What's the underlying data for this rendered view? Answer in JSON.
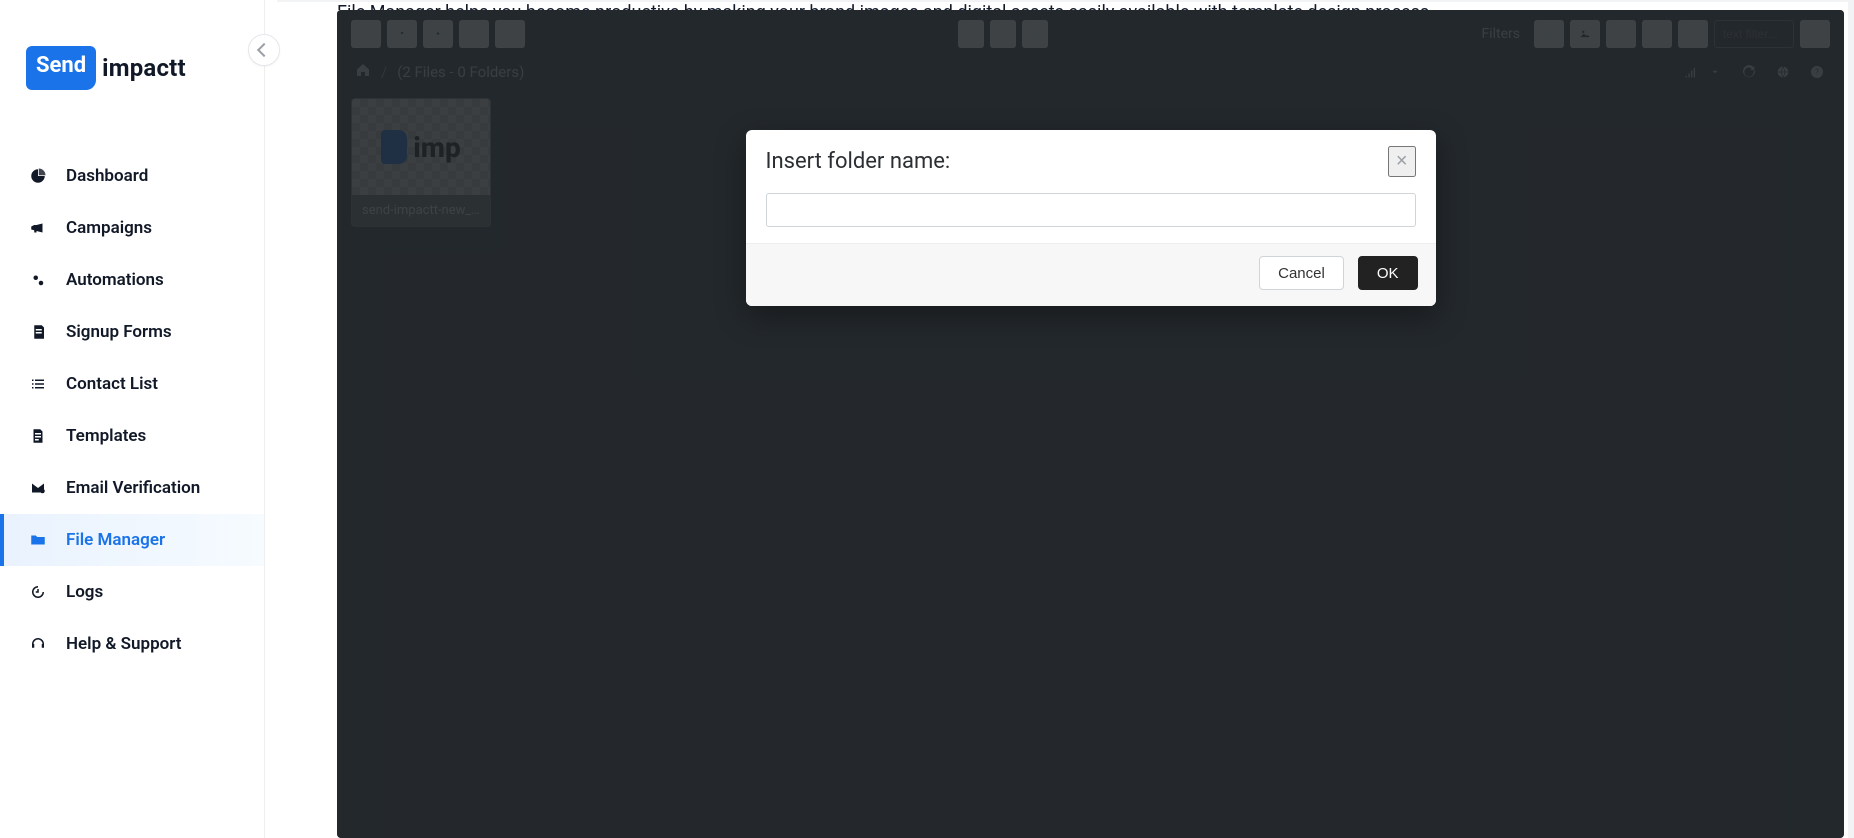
{
  "brand": {
    "badge_text": "Send",
    "word": "impactt"
  },
  "sidebar": {
    "items": [
      {
        "label": "Dashboard",
        "icon": "pie-icon"
      },
      {
        "label": "Campaigns",
        "icon": "megaphone-icon"
      },
      {
        "label": "Automations",
        "icon": "gears-icon"
      },
      {
        "label": "Signup Forms",
        "icon": "form-icon"
      },
      {
        "label": "Contact List",
        "icon": "list-icon"
      },
      {
        "label": "Templates",
        "icon": "template-icon"
      },
      {
        "label": "Email Verification",
        "icon": "shield-check-icon"
      },
      {
        "label": "File Manager",
        "icon": "folder-icon"
      },
      {
        "label": "Logs",
        "icon": "history-icon"
      },
      {
        "label": "Help & Support",
        "icon": "headset-icon"
      }
    ],
    "active_index": 7
  },
  "intro_text": "File Manager helps you become productive by making your brand images and digital assets easily available with template design process.",
  "file_manager": {
    "path": {
      "breadcrumb_count": "(2 Files - 0 Folders)"
    },
    "toolbar": {
      "filters_label": "Filters",
      "text_filter_placeholder": "text filter..."
    },
    "file": {
      "name": "send-impactt-new_...",
      "thumb_text": "imp"
    }
  },
  "modal": {
    "title": "Insert folder name:",
    "input_value": "",
    "cancel_label": "Cancel",
    "ok_label": "OK",
    "close_glyph": "×"
  },
  "colors": {
    "accent": "#1a73e8",
    "panel": "#343a40"
  }
}
